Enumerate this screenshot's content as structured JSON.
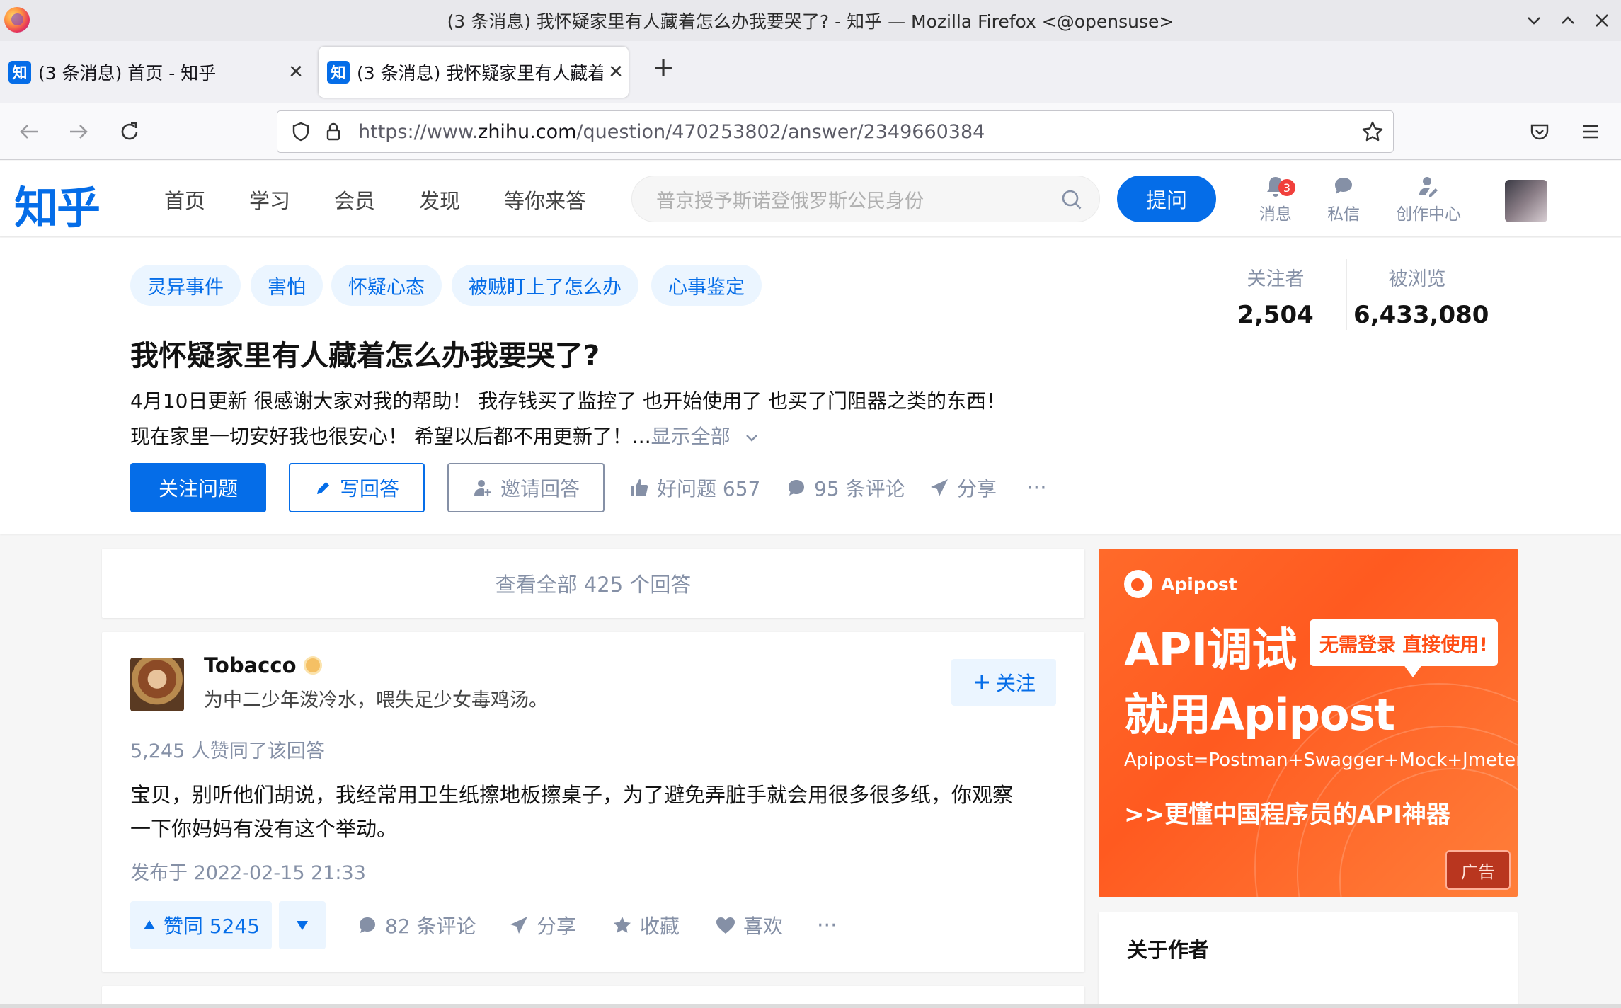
{
  "window": {
    "title": "(3 条消息) 我怀疑家里有人藏着怎么办我要哭了? - 知乎 — Mozilla Firefox <@opensuse>"
  },
  "tabs": [
    {
      "label": "(3 条消息) 首页 - 知乎",
      "favicon": "知"
    },
    {
      "label": "(3 条消息) 我怀疑家里有人藏着怎么办我要哭了? - 知乎",
      "favicon": "知"
    }
  ],
  "urlbar": {
    "prefix": "https://www.",
    "domain": "zhihu.com",
    "path": "/question/470253802/answer/2349660384"
  },
  "header": {
    "logo": "知乎",
    "nav": [
      "首页",
      "学习",
      "会员",
      "发现",
      "等你来答"
    ],
    "search_placeholder": "普京授予斯诺登俄罗斯公民身份",
    "ask_button": "提问",
    "icons": [
      {
        "label": "消息",
        "badge": "3"
      },
      {
        "label": "私信"
      },
      {
        "label": "创作中心"
      }
    ]
  },
  "question": {
    "topics": [
      "灵异事件",
      "害怕",
      "怀疑心态",
      "被贼盯上了怎么办",
      "心事鉴定"
    ],
    "title": "我怀疑家里有人藏着怎么办我要哭了?",
    "description_line1": "4月10日更新 很感谢大家对我的帮助！ 我存钱买了监控了 也开始使用了 也买了门阻器之类的东西！",
    "description_line2": "现在家里一切安好我也很安心！ 希望以后都不用更新了！...",
    "show_all": "显示全部",
    "followers_label": "关注者",
    "followers": "2,504",
    "views_label": "被浏览",
    "views": "6,433,080",
    "follow_button": "关注问题",
    "write_button": "写回答",
    "invite_button": "邀请回答",
    "good_question": "好问题 657",
    "comments": "95 条评论",
    "share": "分享",
    "more": "···"
  },
  "view_all": "查看全部 425 个回答",
  "answer": {
    "author": "Tobacco",
    "bio": "为中二少年泼冷水，喂失足少女毒鸡汤。",
    "follow": "关注",
    "upvoted_by": "5,245 人赞同了该回答",
    "content_line1": "宝贝，别听他们胡说，我经常用卫生纸擦地板擦桌子，为了避免弄脏手就会用很多很多纸，你观察",
    "content_line2": "一下你妈妈有没有这个举动。",
    "published": "发布于 2022-02-15 21:33",
    "upvote": "赞同 5245",
    "comments": "82 条评论",
    "share": "分享",
    "collect": "收藏",
    "like": "喜欢",
    "more": "···"
  },
  "ad": {
    "brand": "Apipost",
    "headline1": "API调试",
    "tag": "无需登录 直接使用!",
    "headline2": "就用Apipost",
    "line": "Apipost=Postman+Swagger+Mock+Jmeter",
    "slogan": ">>更懂中国程序员的API神器",
    "label": "广告"
  },
  "about": {
    "title": "关于作者"
  }
}
